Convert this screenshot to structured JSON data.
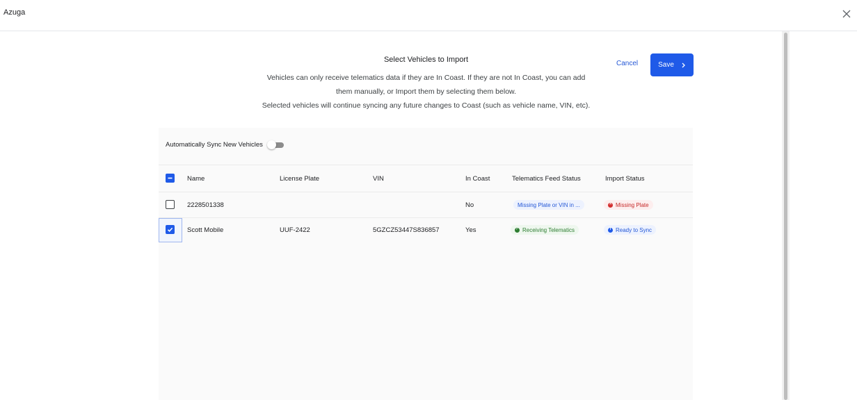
{
  "app": {
    "title": "Azuga",
    "close_icon": "close-icon"
  },
  "header": {
    "title": "Select Vehicles to Import",
    "desc_line1": "Vehicles can only receive telematics data if they are In Coast. If they are not In Coast, you can add",
    "desc_line2": "them manually, or Import them by selecting them below.",
    "desc_line3": "Selected vehicles will continue syncing any future changes to Coast (such as vehicle name, VIN, etc)."
  },
  "actions": {
    "cancel_label": "Cancel",
    "save_label": "Save"
  },
  "sync": {
    "label": "Automatically Sync New Vehicles",
    "enabled": false
  },
  "table": {
    "columns": [
      "Name",
      "License Plate",
      "VIN",
      "In Coast",
      "Telematics Feed Status",
      "Import Status"
    ],
    "header_checkbox": "indeterminate",
    "rows": [
      {
        "selected": false,
        "name": "2228501338",
        "plate": "",
        "vin": "",
        "in_coast": "No",
        "telematics": "Missing Plate or VIN in ...",
        "import": "Missing Plate"
      },
      {
        "selected": true,
        "name": "Scott Mobile",
        "plate": "UUF-2422",
        "vin": "5GZCZ53447S836857",
        "in_coast": "Yes",
        "telematics": "Receiving Telematics",
        "import": "Ready to Sync"
      }
    ]
  },
  "colors": {
    "primary": "#1f5ae8",
    "error": "#d32f2f",
    "success": "#2e7d32"
  }
}
